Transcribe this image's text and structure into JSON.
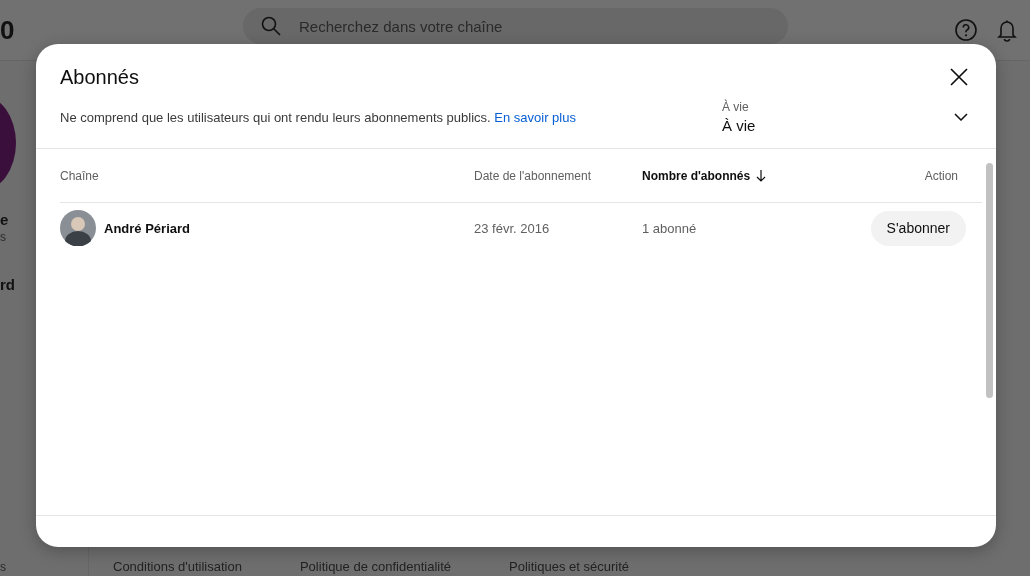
{
  "background": {
    "logo_fragment": "0",
    "search": {
      "placeholder": "Recherchez dans votre chaîne"
    },
    "sidebar_fragments": [
      {
        "text": "e",
        "kind": "title"
      },
      {
        "text": "s",
        "kind": "caption"
      },
      {
        "text": "rd",
        "kind": "title"
      },
      {
        "text": "s",
        "kind": "caption"
      }
    ],
    "footer_links": [
      "Conditions d'utilisation",
      "Politique de confidentialité",
      "Politiques et sécurité"
    ]
  },
  "dialog": {
    "title": "Abonnés",
    "description": {
      "text": "Ne comprend que les utilisateurs qui ont rendu leurs abonnements publics.",
      "link": "En savoir plus"
    },
    "period_filter": {
      "label": "À vie",
      "value": "À vie"
    },
    "table": {
      "columns": [
        {
          "label": "Chaîne",
          "sorted": false
        },
        {
          "label": "Date de l'abonnement",
          "sorted": false
        },
        {
          "label": "Nombre d'abonnés",
          "sorted": true
        },
        {
          "label": "Action",
          "sorted": false
        }
      ],
      "rows": [
        {
          "channel": "André Périard",
          "date": "23 févr. 2016",
          "subscribers": "1 abonné",
          "action": "S'abonner"
        }
      ]
    }
  }
}
